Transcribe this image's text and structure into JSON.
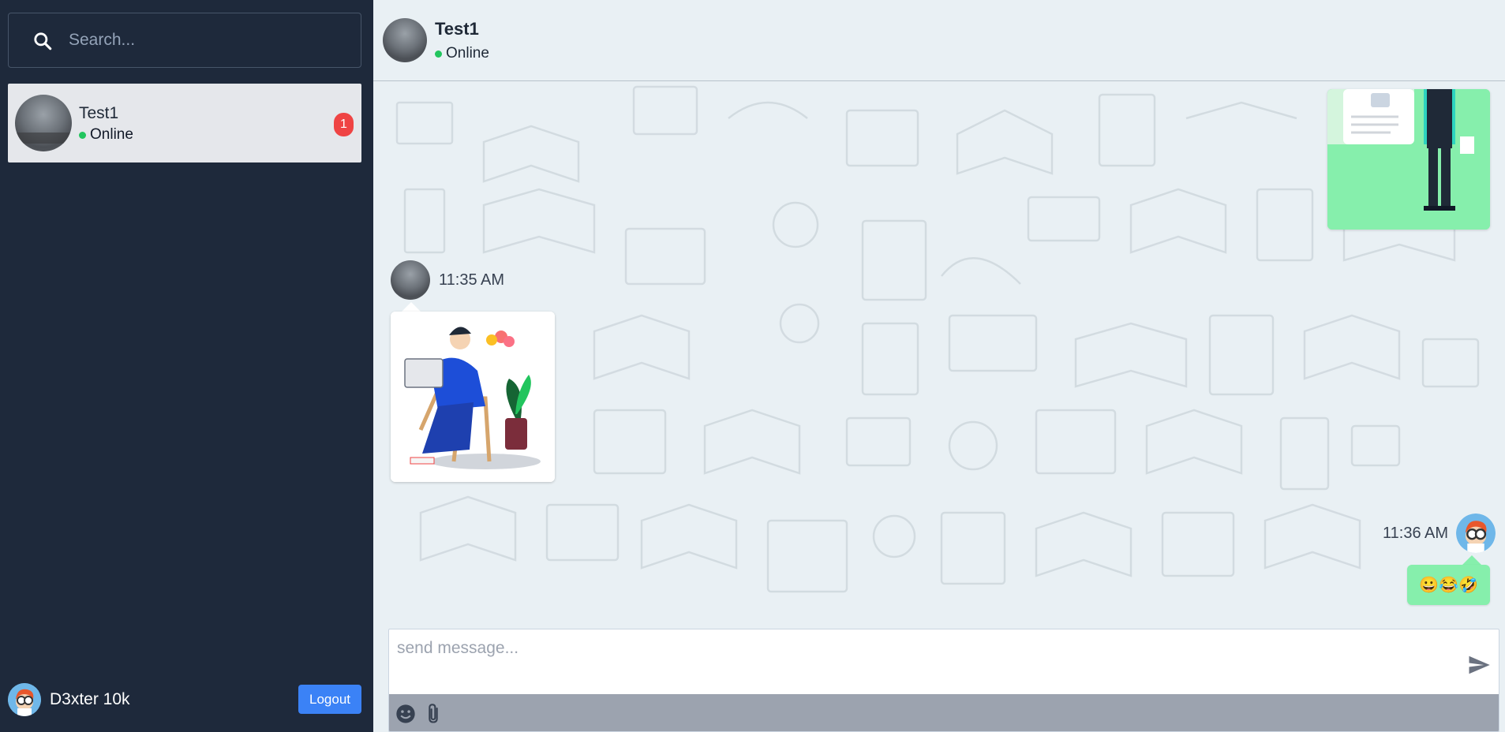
{
  "sidebar": {
    "search": {
      "placeholder": "Search..."
    },
    "contacts": [
      {
        "name": "Test1",
        "status": "Online",
        "unread": "1"
      }
    ],
    "current_user": {
      "name": "D3xter 10k"
    },
    "logout_label": "Logout"
  },
  "chat": {
    "contact_name": "Test1",
    "contact_status": "Online",
    "messages": [
      {
        "time": "11:35 AM"
      },
      {
        "time": "11:36 AM",
        "text": "😀😂🤣"
      }
    ],
    "composer_placeholder": "send message..."
  },
  "colors": {
    "sidebar_bg": "#1e293b",
    "chat_bg": "#e9f0f4",
    "sent_bubble": "#86efac",
    "badge": "#ef4444",
    "logout_button": "#3b82f6",
    "online_dot": "#22c55e"
  },
  "icons": [
    "search-icon",
    "send-icon",
    "emoji-icon",
    "paperclip-icon"
  ]
}
